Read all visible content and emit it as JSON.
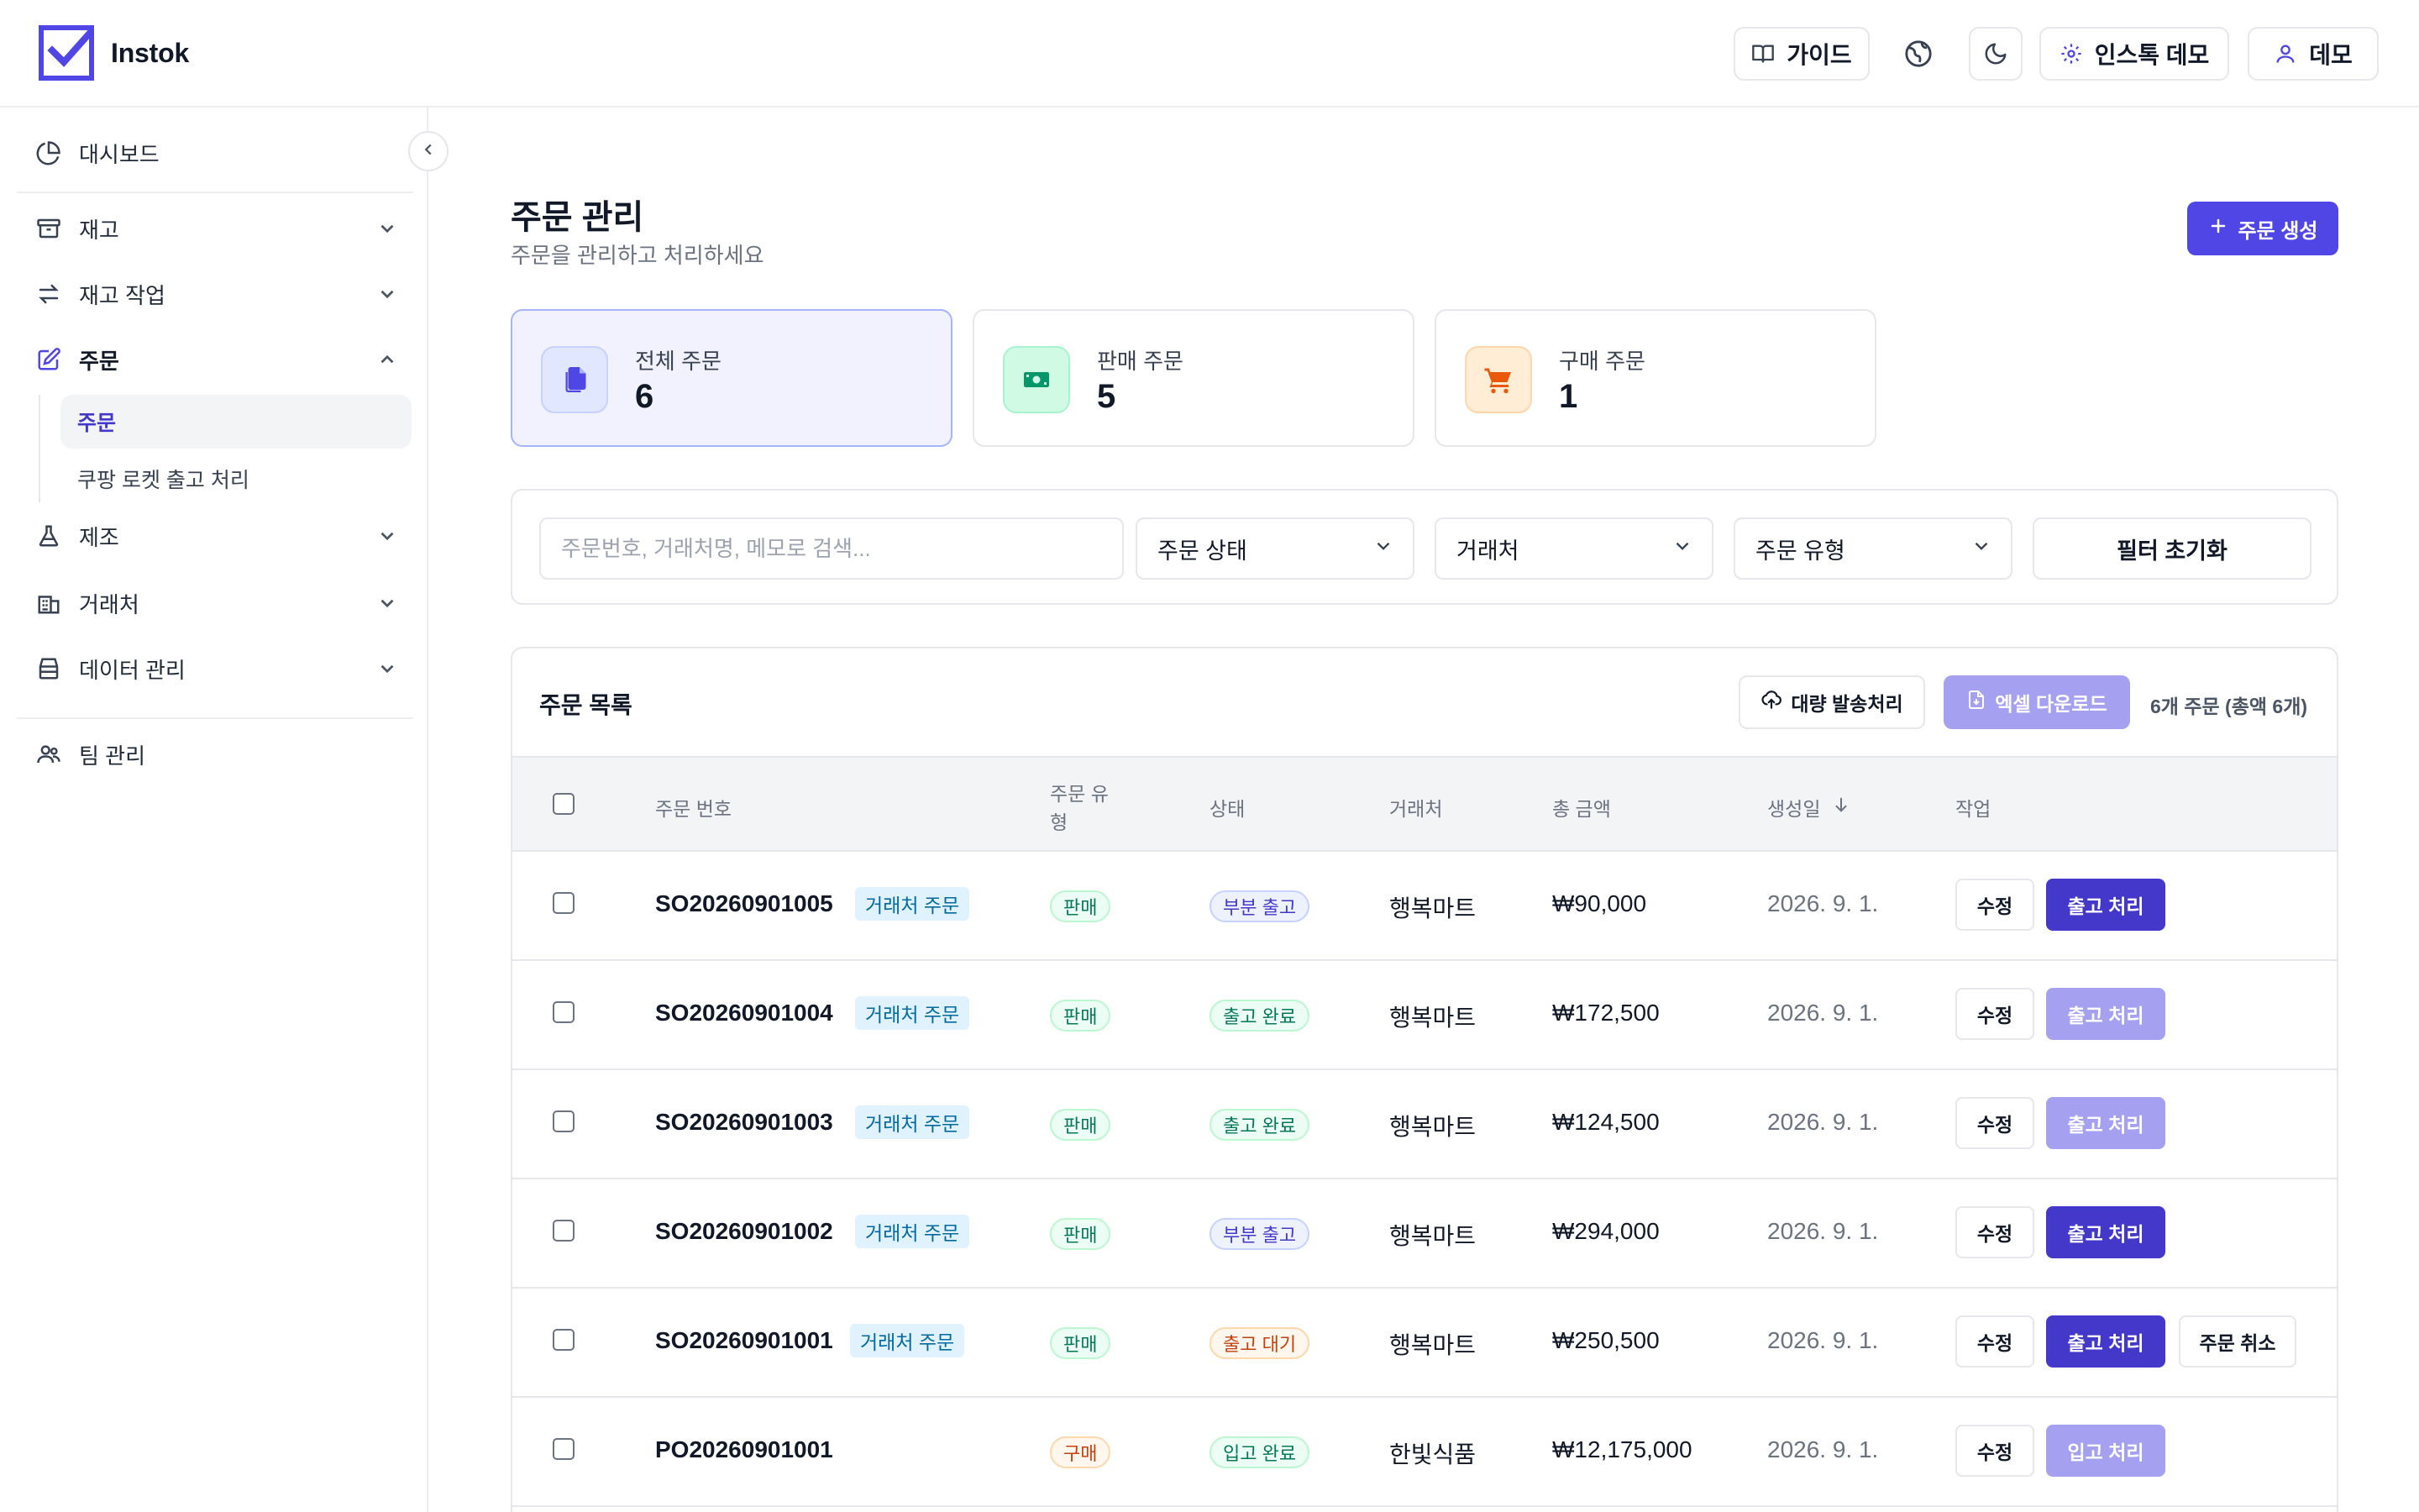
{
  "app": {
    "name": "Instok"
  },
  "header": {
    "guide_label": "가이드",
    "workspace_label": "인스톡 데모",
    "user_label": "데모"
  },
  "sidebar": {
    "items": [
      {
        "label": "대시보드",
        "icon": "pie-chart-icon"
      },
      {
        "label": "재고",
        "icon": "archive-icon"
      },
      {
        "label": "재고 작업",
        "icon": "arrows-exchange-icon"
      },
      {
        "label": "주문",
        "icon": "edit-order-icon"
      },
      {
        "label": "제조",
        "icon": "flask-icon"
      },
      {
        "label": "거래처",
        "icon": "building-icon"
      },
      {
        "label": "데이터 관리",
        "icon": "database-icon"
      },
      {
        "label": "팀 관리",
        "icon": "users-icon"
      }
    ],
    "sub_items": [
      {
        "label": "주문"
      },
      {
        "label": "쿠팡 로켓 출고 처리"
      }
    ]
  },
  "page": {
    "title": "주문 관리",
    "subtitle": "주문을 관리하고 처리하세요",
    "create_label": "주문 생성"
  },
  "stats": [
    {
      "label": "전체 주문",
      "value": "6",
      "icon": "documents-icon"
    },
    {
      "label": "판매 주문",
      "value": "5",
      "icon": "cash-icon"
    },
    {
      "label": "구매 주문",
      "value": "1",
      "icon": "cart-icon"
    }
  ],
  "filters": {
    "search_placeholder": "주문번호, 거래처명, 메모로 검색...",
    "status_label": "주문 상태",
    "customer_label": "거래처",
    "type_label": "주문 유형",
    "reset_label": "필터 초기화"
  },
  "list": {
    "title": "주문 목록",
    "bulk_label": "대량 발송처리",
    "excel_label": "엑셀 다운로드",
    "count_text": "6개 주문 (총액 6개)",
    "columns": {
      "order_no": "주문 번호",
      "type_line1": "주문 유",
      "type_line2": "형",
      "status": "상태",
      "customer": "거래처",
      "amount": "총 금액",
      "created": "생성일",
      "actions": "작업"
    },
    "edit_label": "수정",
    "cancel_label": "주문 취소",
    "rows": [
      {
        "order_no": "SO20260901005",
        "tag": "거래처 주문",
        "type": "판매",
        "status": "부분 출고",
        "customer": "행복마트",
        "amount": "₩90,000",
        "date": "2026. 9. 1.",
        "action": "출고 처리"
      },
      {
        "order_no": "SO20260901004",
        "tag": "거래처 주문",
        "type": "판매",
        "status": "출고 완료",
        "customer": "행복마트",
        "amount": "₩172,500",
        "date": "2026. 9. 1.",
        "action": "출고 처리"
      },
      {
        "order_no": "SO20260901003",
        "tag": "거래처 주문",
        "type": "판매",
        "status": "출고 완료",
        "customer": "행복마트",
        "amount": "₩124,500",
        "date": "2026. 9. 1.",
        "action": "출고 처리"
      },
      {
        "order_no": "SO20260901002",
        "tag": "거래처 주문",
        "type": "판매",
        "status": "부분 출고",
        "customer": "행복마트",
        "amount": "₩294,000",
        "date": "2026. 9. 1.",
        "action": "출고 처리"
      },
      {
        "order_no": "SO20260901001",
        "tag": "거래처 주문",
        "type": "판매",
        "status": "출고 대기",
        "customer": "행복마트",
        "amount": "₩250,500",
        "date": "2026. 9. 1.",
        "action": "출고 처리"
      },
      {
        "order_no": "PO20260901001",
        "tag": "",
        "type": "구매",
        "status": "입고 완료",
        "customer": "한빛식품",
        "amount": "₩12,175,000",
        "date": "2026. 9. 1.",
        "action": "입고 처리"
      }
    ]
  },
  "colors": {
    "primary": "#4f46e5",
    "primary_disabled": "#a5a1f0",
    "active_card_bg": "#f1f2fd"
  }
}
